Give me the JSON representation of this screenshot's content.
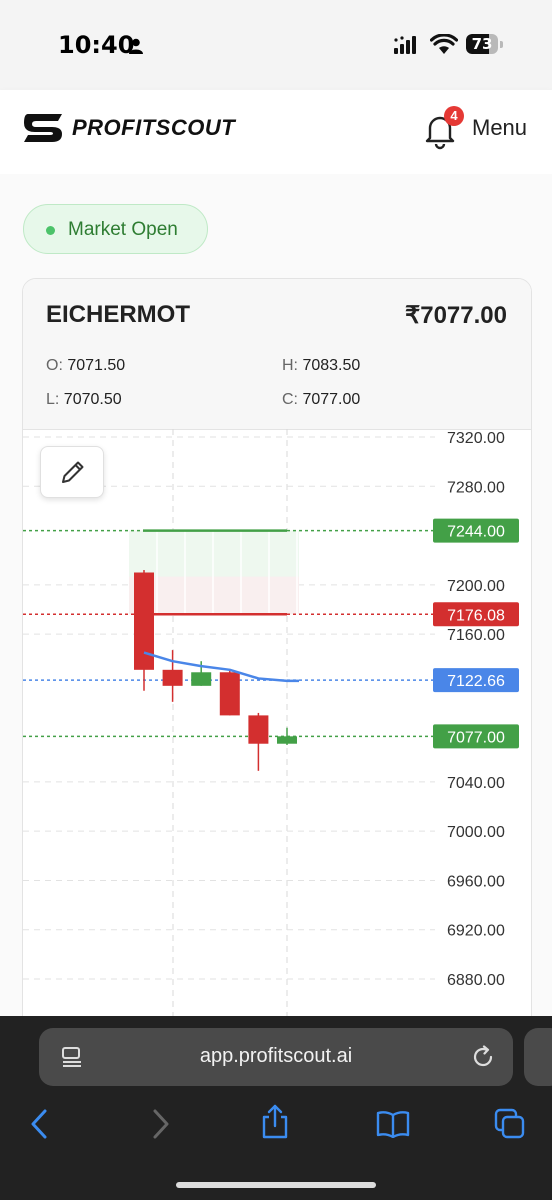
{
  "status_bar": {
    "time": "10:40",
    "battery": "73",
    "battery_level": 0.73
  },
  "header": {
    "brand": "PROFITSCOUT",
    "notification_count": "4",
    "menu_label": "Menu"
  },
  "market_status": {
    "label": "Market Open",
    "color": "#4cc36a"
  },
  "quote": {
    "symbol": "EICHERMOT",
    "price": "₹7077.00",
    "open_label": "O:",
    "open": "7071.50",
    "high_label": "H:",
    "high": "7083.50",
    "low_label": "L:",
    "low": "7070.50",
    "close_label": "C:",
    "close": "7077.00"
  },
  "chart_data": {
    "type": "candlestick",
    "y_ticks": [
      "7320.00",
      "7280.00",
      "7200.00",
      "7160.00",
      "7040.00",
      "7000.00",
      "6960.00",
      "6920.00",
      "6880.00"
    ],
    "y_tick_values": [
      7320,
      7280,
      7200,
      7160,
      7040,
      7000,
      6960,
      6920,
      6880
    ],
    "candles": [
      {
        "open": 7210,
        "close": 7131,
        "high": 7212,
        "low": 7114,
        "color": "#d32f2f"
      },
      {
        "open": 7131,
        "close": 7118,
        "high": 7147,
        "low": 7105,
        "color": "#d32f2f"
      },
      {
        "open": 7118,
        "close": 7129,
        "high": 7138,
        "low": 7118,
        "color": "#43a047"
      },
      {
        "open": 7129,
        "close": 7094,
        "high": 7131,
        "low": 7094,
        "color": "#d32f2f"
      },
      {
        "open": 7094,
        "close": 7071,
        "high": 7096,
        "low": 7049,
        "color": "#d32f2f"
      },
      {
        "open": 7071,
        "close": 7077,
        "high": 7084,
        "low": 7070,
        "color": "#43a047"
      }
    ],
    "moving_average": [
      7145,
      7138,
      7134,
      7131,
      7124,
      7122
    ],
    "price_lines": [
      {
        "value": 7244.0,
        "label": "7244.00",
        "color": "#43a047"
      },
      {
        "value": 7176.08,
        "label": "7176.08",
        "color": "#d32f2f"
      },
      {
        "value": 7122.66,
        "label": "7122.66",
        "color": "#4a86e8"
      },
      {
        "value": 7077.0,
        "label": "7077.00",
        "color": "#43a047"
      }
    ],
    "target_zone": {
      "from": 7176.08,
      "to": 7244.0
    }
  },
  "browser": {
    "url": "app.profitscout.ai"
  },
  "colors": {
    "up": "#43a047",
    "down": "#d32f2f",
    "ma": "#4a86e8"
  }
}
